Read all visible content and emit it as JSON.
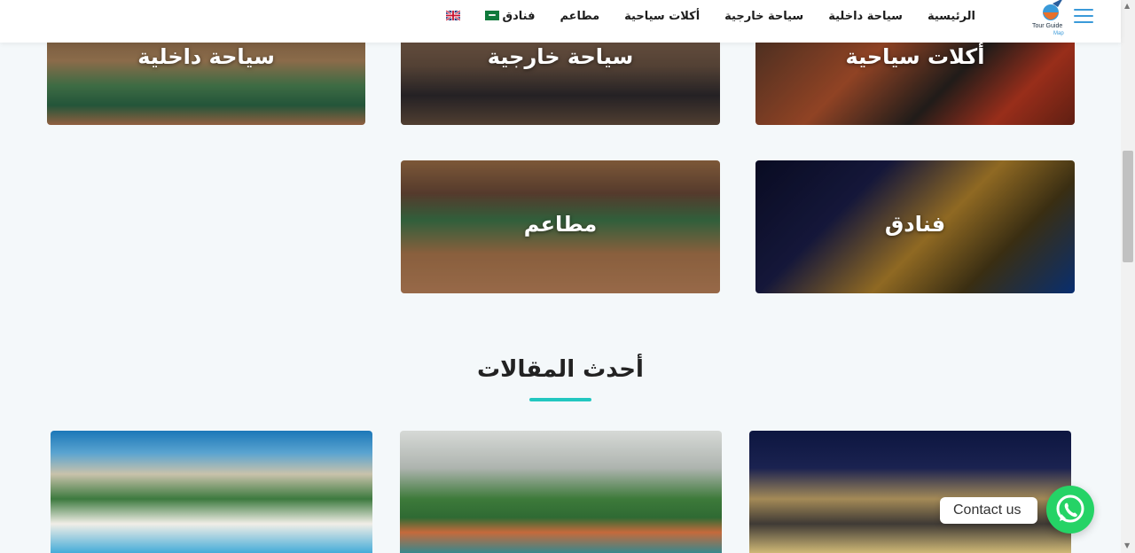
{
  "header": {
    "logo_text": "Tour Guide",
    "logo_sub": "Map",
    "nav_items": [
      "الرئيسية",
      "سياحة داخلية",
      "سياحة خارجية",
      "أكلات سياحية",
      "مطاعم",
      "فنادق"
    ],
    "flags": [
      "saudi-flag-icon",
      "uk-flag-icon"
    ]
  },
  "categories": [
    {
      "label": "سياحة داخلية"
    },
    {
      "label": "سياحة خارجية"
    },
    {
      "label": "أكلات سياحية"
    },
    {
      "label": "مطاعم"
    },
    {
      "label": "فنادق"
    }
  ],
  "articles_section": {
    "title": "أحدث المقالات"
  },
  "contact": {
    "label": "Contact us"
  },
  "colors": {
    "accent": "#22c7c0",
    "whatsapp": "#25d366",
    "menu": "#3a9ad9"
  }
}
